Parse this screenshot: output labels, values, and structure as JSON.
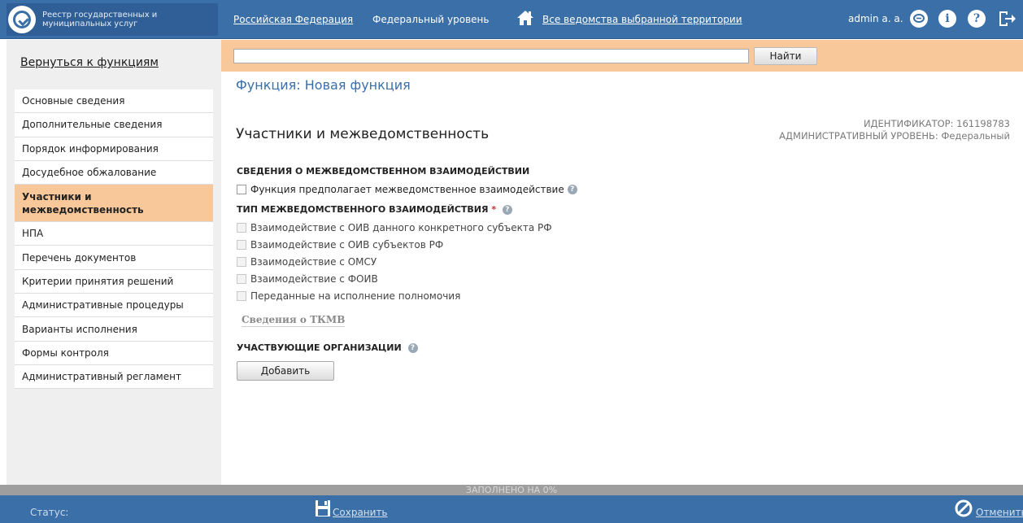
{
  "header": {
    "logo_line1": "Реестр государственных и",
    "logo_line2": "муниципальных услуг",
    "region": "Российская Федерация",
    "level": "Федеральный уровень",
    "agencies": "Все ведомства выбранной территории",
    "user": "admin a. a.",
    "icons": [
      "chat-icon",
      "info-icon",
      "help-icon",
      "exit-icon"
    ]
  },
  "sidebar": {
    "back_link": "Вернуться к функциям",
    "items": [
      {
        "label": "Основные сведения"
      },
      {
        "label": "Дополнительные сведения"
      },
      {
        "label": "Порядок информирования"
      },
      {
        "label": "Досудебное обжалование"
      },
      {
        "label": "Участники и межведомственность",
        "active": true
      },
      {
        "label": "НПА"
      },
      {
        "label": "Перечень документов"
      },
      {
        "label": "Критерии принятия решений"
      },
      {
        "label": "Административные процедуры"
      },
      {
        "label": "Варианты исполнения"
      },
      {
        "label": "Формы контроля"
      },
      {
        "label": "Административный регламент"
      }
    ]
  },
  "search": {
    "value": "",
    "button": "Найти"
  },
  "main": {
    "function_title": "Функция: Новая функция",
    "section_title": "Участники и межведомственность",
    "identifier": "ИДЕНТИФИКАТОР: 161198783",
    "admin_level": "АДМИНИСТРАТИВНЫЙ УРОВЕНЬ: Федеральный",
    "interaction_heading": "СВЕДЕНИЯ О МЕЖВЕДОМСТВЕННОМ ВЗАИМОДЕЙСТВИИ",
    "interaction_checkbox": "Функция предполагает межведомственное взаимодействие",
    "type_heading": "ТИП МЕЖВЕДОМСТВЕННОГО ВЗАИМОДЕЙСТВИЯ",
    "required_mark": "*",
    "types": [
      "Взаимодействие с ОИВ данного конкретного субъекта РФ",
      "Взаимодействие с ОИВ субъектов РФ",
      "Взаимодействие с ОМСУ",
      "Взаимодействие с ФОИВ",
      "Переданные на исполнение полномочия"
    ],
    "tkmv_link": "Сведения о ТКМВ",
    "orgs_heading": "УЧАСТВУЮЩИЕ ОРГАНИЗАЦИИ",
    "add_button": "Добавить"
  },
  "footer": {
    "progress_text": "ЗАПОЛНЕНО НА 0%",
    "progress": 0,
    "status_label": "Статус:",
    "save": "Сохранить",
    "cancel": "Отменить"
  },
  "colors": {
    "header_blue": "#3a6fa8",
    "accent_orange": "#f9c89a",
    "title_blue": "#3a6fa8"
  }
}
